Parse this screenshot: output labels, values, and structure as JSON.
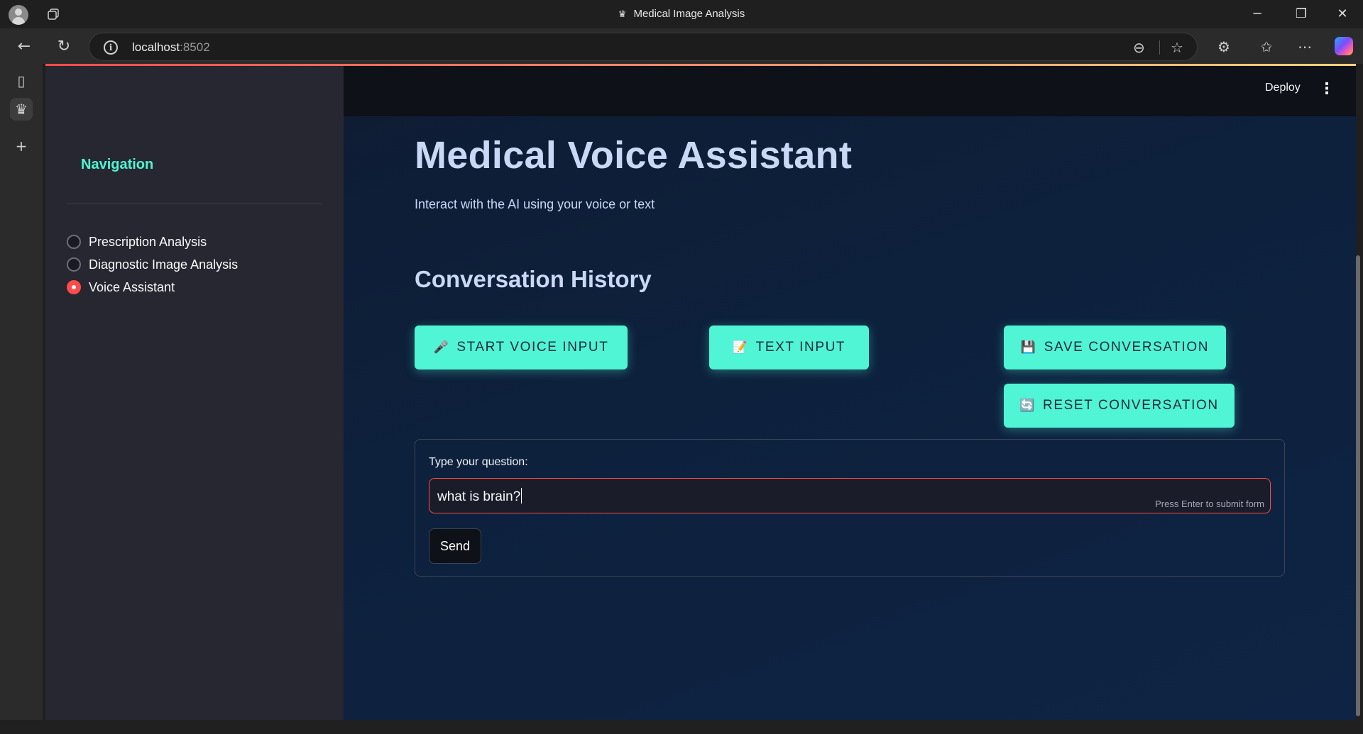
{
  "browser": {
    "window_title": "Medical Image Analysis",
    "url_host": "localhost",
    "url_port": ":8502"
  },
  "app": {
    "deploy_label": "Deploy",
    "sidebar": {
      "title": "Navigation",
      "options": [
        {
          "label": "Prescription Analysis",
          "selected": false
        },
        {
          "label": "Diagnostic Image Analysis",
          "selected": false
        },
        {
          "label": "Voice Assistant",
          "selected": true
        }
      ]
    },
    "main": {
      "title": "Medical Voice Assistant",
      "subtitle": "Interact with the AI using your voice or text",
      "section_title": "Conversation History",
      "buttons": {
        "start_voice": {
          "icon": "🎤",
          "label": "START VOICE INPUT"
        },
        "text_input": {
          "icon": "📝",
          "label": "TEXT INPUT"
        },
        "save": {
          "icon": "💾",
          "label": "SAVE CONVERSATION"
        },
        "reset": {
          "icon": "🔄",
          "label": "RESET CONVERSATION"
        }
      },
      "form": {
        "label": "Type your question:",
        "value": "what is brain?",
        "hint": "Press Enter to submit form",
        "send_label": "Send"
      }
    }
  },
  "colors": {
    "accent": "#4ff5d4",
    "primary": "#ff4b4b",
    "sidebar_bg": "#262730",
    "main_bg": "#0d213d"
  }
}
